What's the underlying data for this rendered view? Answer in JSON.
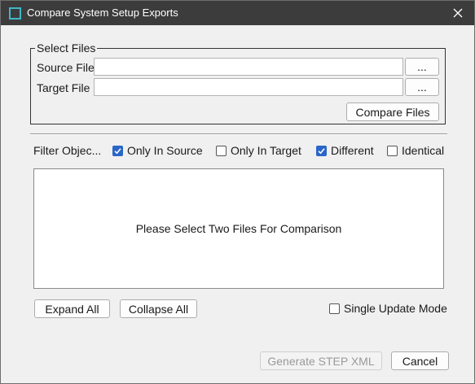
{
  "window": {
    "title": "Compare System Setup Exports"
  },
  "select_files": {
    "legend": "Select Files",
    "source_label": "Source File",
    "source_value": "",
    "target_label": "Target File",
    "target_value": "",
    "browse_label": "...",
    "compare_label": "Compare Files"
  },
  "filter": {
    "label": "Filter Objec...",
    "options": [
      {
        "label": "Only In Source",
        "checked": true
      },
      {
        "label": "Only In Target",
        "checked": false
      },
      {
        "label": "Different",
        "checked": true
      },
      {
        "label": "Identical",
        "checked": false
      }
    ]
  },
  "results": {
    "placeholder": "Please Select Two Files For Comparison"
  },
  "tree_actions": {
    "expand_label": "Expand All",
    "collapse_label": "Collapse All",
    "single_update_label": "Single Update Mode",
    "single_update_checked": false
  },
  "footer": {
    "generate_label": "Generate STEP XML",
    "generate_enabled": false,
    "cancel_label": "Cancel"
  },
  "colors": {
    "titlebar": "#3c3c3c",
    "accent": "#2a66c8",
    "icon": "#3fb8c9"
  }
}
